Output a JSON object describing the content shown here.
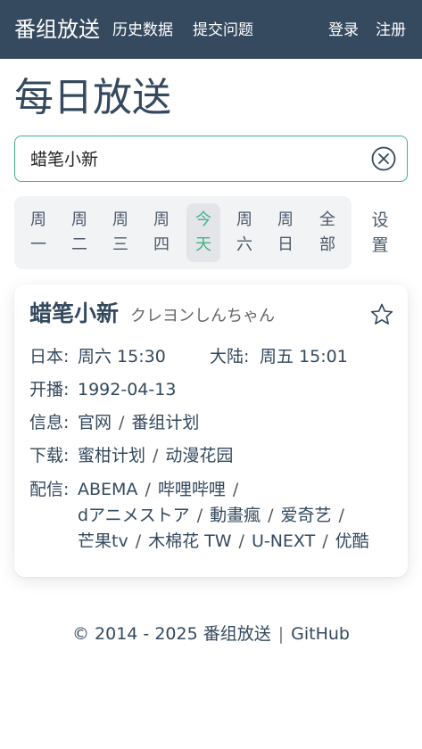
{
  "nav": {
    "brand": "番组放送",
    "history": "历史数据",
    "issue": "提交问题",
    "login": "登录",
    "register": "注册"
  },
  "page": {
    "title": "每日放送"
  },
  "search": {
    "value": "蜡笔小新"
  },
  "days": [
    {
      "top": "周",
      "bottom": "一"
    },
    {
      "top": "周",
      "bottom": "二"
    },
    {
      "top": "周",
      "bottom": "三"
    },
    {
      "top": "周",
      "bottom": "四"
    },
    {
      "top": "今",
      "bottom": "天"
    },
    {
      "top": "周",
      "bottom": "六"
    },
    {
      "top": "周",
      "bottom": "日"
    },
    {
      "top": "全",
      "bottom": "部"
    }
  ],
  "settings": {
    "top": "设",
    "bottom": "置"
  },
  "card": {
    "title_cn": "蜡笔小新",
    "title_jp": "クレヨンしんちゃん",
    "jp_label": "日本:",
    "jp_time": "周六 15:30",
    "cn_label": "大陆:",
    "cn_time": "周五 15:01",
    "start_label": "开播:",
    "start_date": "1992-04-13",
    "info_label": "信息:",
    "info_links": [
      "官网",
      "番组计划"
    ],
    "dl_label": "下载:",
    "dl_links": [
      "蜜柑计划",
      "动漫花园"
    ],
    "stream_label": "配信:",
    "stream_links": [
      "ABEMA",
      "哔哩哔哩",
      "dアニメストア",
      "動畫瘋",
      "爱奇艺",
      "芒果tv",
      "木棉花 TW",
      "U-NEXT",
      "优酷"
    ],
    "separator": "/"
  },
  "footer": {
    "copyright": "© 2014 - 2025 番组放送",
    "divider": "|",
    "github": "GitHub"
  },
  "colors": {
    "navbar": "#364a5f",
    "accent": "#3fb383",
    "text": "#34495e"
  }
}
